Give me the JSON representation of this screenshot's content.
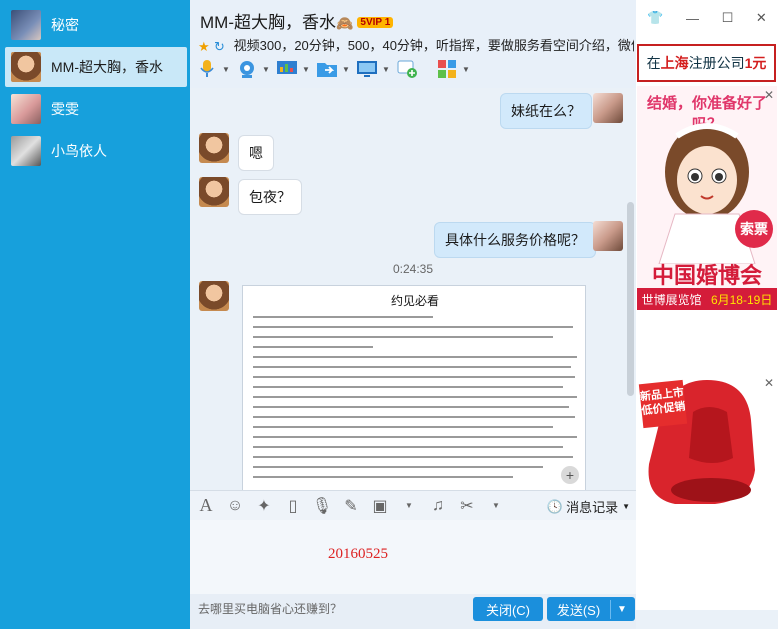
{
  "contacts": [
    {
      "name": "秘密",
      "active": false
    },
    {
      "name": "MM-超大胸，香水",
      "active": true
    },
    {
      "name": "雯雯",
      "active": false
    },
    {
      "name": "小鸟依人",
      "active": false
    }
  ],
  "chat": {
    "title": "MM-超大胸，香水",
    "vip": "5VIP 1",
    "status": "视频300，20分钟，500，40分钟，听指挥，要做服务看空间介绍，微信..."
  },
  "messages": [
    {
      "from": "me",
      "text": "妹纸在么？"
    },
    {
      "from": "them",
      "text": "嗯"
    },
    {
      "from": "them",
      "text": "包夜？"
    },
    {
      "from": "me",
      "text": "具体什么服务价格呢？"
    }
  ],
  "timestamp": "0:24:35",
  "image_message": {
    "title": "约见必看"
  },
  "input": {
    "history_label": "消息记录",
    "draft_text": "20160525",
    "ad_link": "去哪里买电脑省心还赚到？",
    "close_label": "关闭(C)",
    "send_label": "发送(S)"
  },
  "ads": {
    "top_text_prefix": "在",
    "top_text_red1": "上海",
    "top_text_mid": "注册公司",
    "top_text_red2": "1元",
    "wedding_heading": "结婚，你准备好了吗？",
    "wedding_title": "中国婚博会",
    "wedding_venue": "世博展览馆",
    "wedding_date": "6月18-19日",
    "wedding_ticket": "索票",
    "seat_tag": "新品上市 低价促销"
  },
  "colors": {
    "sidebar": "#17a0dc",
    "accent_button": "#1b8fdc",
    "draft_text": "#dd2222"
  }
}
